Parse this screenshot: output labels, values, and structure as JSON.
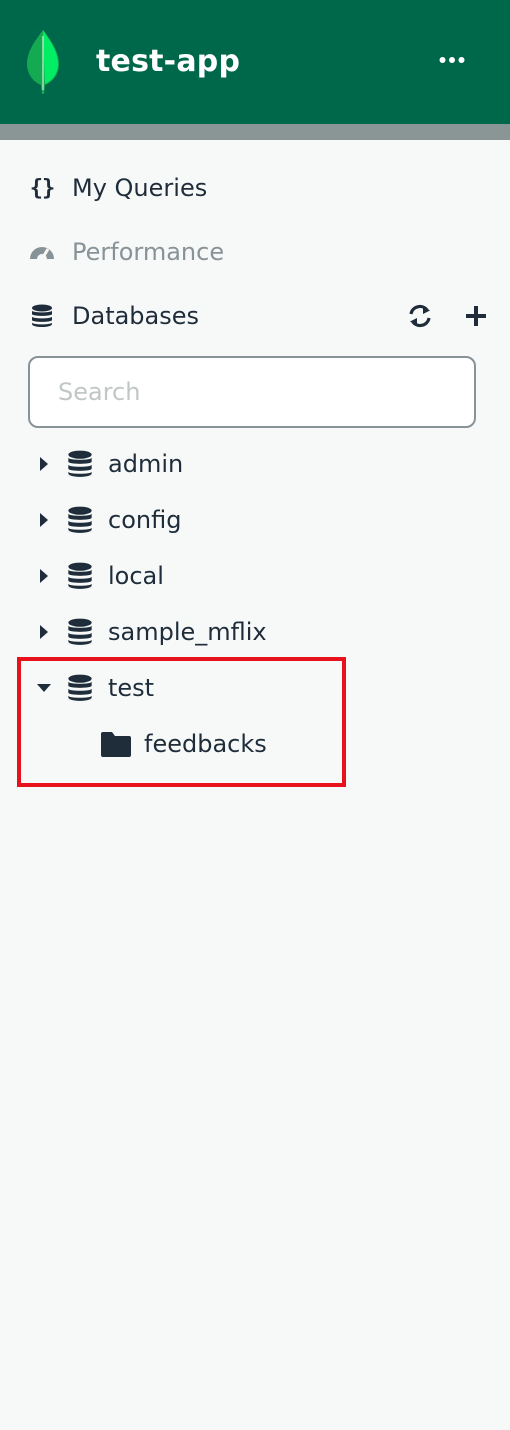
{
  "app": {
    "title": "test-app",
    "more_icon": "more-horizontal-icon",
    "logo_icon": "mongodb-leaf-logo",
    "header_color": "#00684a"
  },
  "nav": {
    "my_queries": {
      "label": "My Queries",
      "icon": "curly-braces-icon"
    },
    "performance": {
      "label": "Performance",
      "icon": "gauge-icon"
    },
    "databases": {
      "label": "Databases",
      "icon": "database-icon",
      "refresh_icon": "refresh-icon",
      "add_icon": "plus-icon"
    }
  },
  "search": {
    "placeholder": "Search",
    "value": ""
  },
  "databases": [
    {
      "name": "admin",
      "expanded": false
    },
    {
      "name": "config",
      "expanded": false
    },
    {
      "name": "local",
      "expanded": false
    },
    {
      "name": "sample_mflix",
      "expanded": false
    },
    {
      "name": "test",
      "expanded": true,
      "collections": [
        {
          "name": "feedbacks",
          "icon": "folder-icon"
        }
      ]
    }
  ],
  "highlight_color": "#e8121c"
}
